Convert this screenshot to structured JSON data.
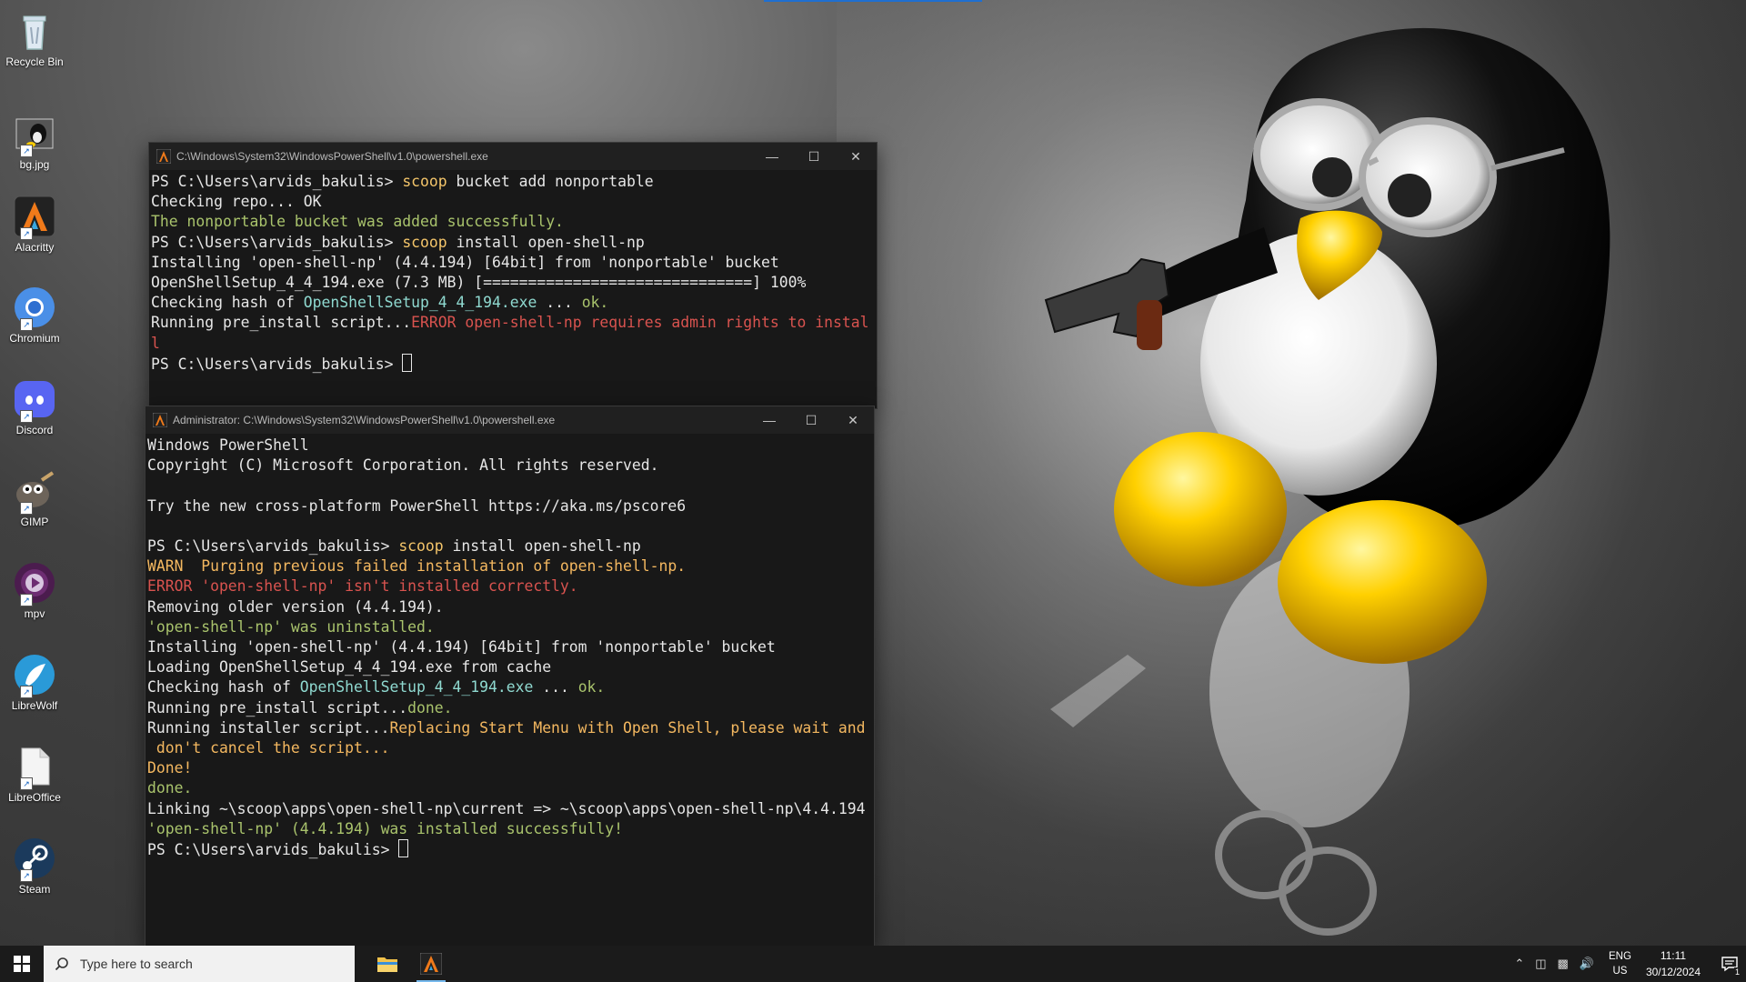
{
  "desktop": {
    "icons": [
      {
        "label": "Recycle Bin",
        "icon": "recycle-bin-icon"
      },
      {
        "label": "bg.jpg",
        "icon": "image-file-icon"
      },
      {
        "label": "Alacritty",
        "icon": "alacritty-icon"
      },
      {
        "label": "Chromium",
        "icon": "chromium-icon"
      },
      {
        "label": "Discord",
        "icon": "discord-icon"
      },
      {
        "label": "GIMP",
        "icon": "gimp-icon"
      },
      {
        "label": "mpv",
        "icon": "mpv-icon"
      },
      {
        "label": "LibreWolf",
        "icon": "librewolf-icon"
      },
      {
        "label": "LibreOffice",
        "icon": "libreoffice-icon"
      },
      {
        "label": "Steam",
        "icon": "steam-icon"
      }
    ]
  },
  "window1": {
    "title": "C:\\Windows\\System32\\WindowsPowerShell\\v1.0\\powershell.exe",
    "lines": [
      [
        {
          "t": "PS C:\\Users\\arvids_bakulis> ",
          "c": ""
        },
        {
          "t": "scoop",
          "c": "c-yel"
        },
        {
          "t": " bucket add nonportable",
          "c": ""
        }
      ],
      [
        {
          "t": "Checking repo... OK",
          "c": ""
        }
      ],
      [
        {
          "t": "The nonportable bucket was added successfully.",
          "c": "c-grn"
        }
      ],
      [
        {
          "t": "PS C:\\Users\\arvids_bakulis> ",
          "c": ""
        },
        {
          "t": "scoop",
          "c": "c-yel"
        },
        {
          "t": " install open-shell-np",
          "c": ""
        }
      ],
      [
        {
          "t": "Installing 'open-shell-np' (4.4.194) [64bit] from 'nonportable' bucket",
          "c": ""
        }
      ],
      [
        {
          "t": "OpenShellSetup_4_4_194.exe (7.3 MB) [==============================] 100%",
          "c": ""
        }
      ],
      [
        {
          "t": "Checking hash of ",
          "c": ""
        },
        {
          "t": "OpenShellSetup_4_4_194.exe",
          "c": "c-cyan"
        },
        {
          "t": " ... ",
          "c": ""
        },
        {
          "t": "ok.",
          "c": "c-grn"
        }
      ],
      [
        {
          "t": "Running pre_install script...",
          "c": ""
        },
        {
          "t": "ERROR open-shell-np requires admin rights to instal",
          "c": "c-red"
        }
      ],
      [
        {
          "t": "l",
          "c": "c-red"
        }
      ],
      [
        {
          "t": "PS C:\\Users\\arvids_bakulis> ",
          "c": ""
        }
      ]
    ]
  },
  "window2": {
    "title": "Administrator: C:\\Windows\\System32\\WindowsPowerShell\\v1.0\\powershell.exe",
    "lines": [
      [
        {
          "t": "Windows PowerShell",
          "c": ""
        }
      ],
      [
        {
          "t": "Copyright (C) Microsoft Corporation. All rights reserved.",
          "c": ""
        }
      ],
      [
        {
          "t": "",
          "c": ""
        }
      ],
      [
        {
          "t": "Try the new cross-platform PowerShell https://aka.ms/pscore6",
          "c": ""
        }
      ],
      [
        {
          "t": "",
          "c": ""
        }
      ],
      [
        {
          "t": "PS C:\\Users\\arvids_bakulis> ",
          "c": ""
        },
        {
          "t": "scoop",
          "c": "c-yel"
        },
        {
          "t": " install open-shell-np",
          "c": ""
        }
      ],
      [
        {
          "t": "WARN  Purging previous failed installation of open-shell-np.",
          "c": "c-gold"
        }
      ],
      [
        {
          "t": "ERROR 'open-shell-np' isn't installed correctly.",
          "c": "c-red"
        }
      ],
      [
        {
          "t": "Removing older version (4.4.194).",
          "c": ""
        }
      ],
      [
        {
          "t": "'open-shell-np' was uninstalled.",
          "c": "c-grn"
        }
      ],
      [
        {
          "t": "Installing 'open-shell-np' (4.4.194) [64bit] from 'nonportable' bucket",
          "c": ""
        }
      ],
      [
        {
          "t": "Loading OpenShellSetup_4_4_194.exe from cache",
          "c": ""
        }
      ],
      [
        {
          "t": "Checking hash of ",
          "c": ""
        },
        {
          "t": "OpenShellSetup_4_4_194.exe",
          "c": "c-cyan"
        },
        {
          "t": " ... ",
          "c": ""
        },
        {
          "t": "ok.",
          "c": "c-grn"
        }
      ],
      [
        {
          "t": "Running pre_install script...",
          "c": ""
        },
        {
          "t": "done.",
          "c": "c-grn"
        }
      ],
      [
        {
          "t": "Running installer script...",
          "c": ""
        },
        {
          "t": "Replacing Start Menu with Open Shell, please wait and",
          "c": "c-gold"
        }
      ],
      [
        {
          "t": " don't cancel the script...",
          "c": "c-gold"
        }
      ],
      [
        {
          "t": "Done!",
          "c": "c-gold"
        }
      ],
      [
        {
          "t": "done.",
          "c": "c-grn"
        }
      ],
      [
        {
          "t": "Linking ~\\scoop\\apps\\open-shell-np\\current => ~\\scoop\\apps\\open-shell-np\\4.4.194",
          "c": ""
        }
      ],
      [
        {
          "t": "'open-shell-np' (4.4.194) was installed successfully!",
          "c": "c-grn"
        }
      ],
      [
        {
          "t": "PS C:\\Users\\arvids_bakulis> ",
          "c": ""
        }
      ]
    ]
  },
  "taskbar": {
    "search_placeholder": "Type here to search",
    "lang_top": "ENG",
    "lang_bottom": "US",
    "time": "11:11",
    "date": "30/12/2024",
    "notification_count": "1"
  },
  "colors": {
    "accent": "#76b9ed",
    "alacritty_orange": "#f07a1a",
    "terminal_bg": "#181818"
  }
}
